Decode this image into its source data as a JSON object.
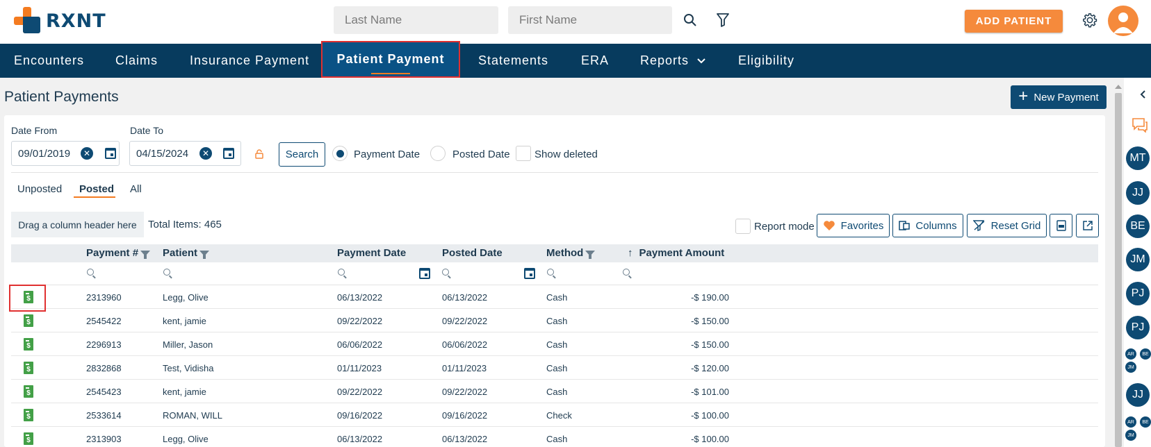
{
  "app": {
    "logo_text": "RXNT",
    "add_patient_label": "ADD PATIENT"
  },
  "header": {
    "last_name_placeholder": "Last Name",
    "first_name_placeholder": "First Name"
  },
  "nav": {
    "items": [
      {
        "label": "Encounters"
      },
      {
        "label": "Claims"
      },
      {
        "label": "Insurance Payment"
      },
      {
        "label": "Patient Payment",
        "active": true
      },
      {
        "label": "Statements"
      },
      {
        "label": "ERA"
      },
      {
        "label": "Reports"
      },
      {
        "label": "Eligibility"
      }
    ]
  },
  "page": {
    "title": "Patient Payments",
    "new_payment_label": "New Payment",
    "new_payment_icon": "+"
  },
  "filters": {
    "date_from_label": "Date From",
    "date_from_value": "09/01/2019",
    "date_to_label": "Date To",
    "date_to_value": "04/15/2024",
    "search_label": "Search",
    "payment_date_label": "Payment Date",
    "posted_date_label": "Posted Date",
    "show_deleted_label": "Show deleted",
    "selected_date_type": "Payment Date"
  },
  "tabs": [
    {
      "label": "Unposted"
    },
    {
      "label": "Posted",
      "active": true
    },
    {
      "label": "All"
    }
  ],
  "grid_toolbar": {
    "drag_hint": "Drag a column header here",
    "total_items": "Total Items: 465",
    "report_mode_label": "Report mode",
    "favorites_label": "Favorites",
    "columns_label": "Columns",
    "reset_grid_label": "Reset Grid"
  },
  "grid": {
    "headers": [
      "Payment #",
      "Patient",
      "Payment Date",
      "Posted Date",
      "Method",
      "Payment Amount"
    ],
    "rows": [
      {
        "payment_no": "2313960",
        "patient": "Legg, Olive",
        "payment_date": "06/13/2022",
        "posted_date": "06/13/2022",
        "method": "Cash",
        "amount": "-$ 190.00"
      },
      {
        "payment_no": "2545422",
        "patient": "kent, jamie",
        "payment_date": "09/22/2022",
        "posted_date": "09/22/2022",
        "method": "Cash",
        "amount": "-$ 150.00"
      },
      {
        "payment_no": "2296913",
        "patient": "Miller, Jason",
        "payment_date": "06/06/2022",
        "posted_date": "06/06/2022",
        "method": "Cash",
        "amount": "-$ 150.00"
      },
      {
        "payment_no": "2832868",
        "patient": "Test, Vidisha",
        "payment_date": "01/11/2023",
        "posted_date": "01/11/2023",
        "method": "Cash",
        "amount": "-$ 120.00"
      },
      {
        "payment_no": "2545423",
        "patient": "kent, jamie",
        "payment_date": "09/22/2022",
        "posted_date": "09/22/2022",
        "method": "Cash",
        "amount": "-$ 101.00"
      },
      {
        "payment_no": "2533614",
        "patient": "ROMAN, WILL",
        "payment_date": "09/16/2022",
        "posted_date": "09/16/2022",
        "method": "Check",
        "amount": "-$ 100.00"
      },
      {
        "payment_no": "2313903",
        "patient": "Legg, Olive",
        "payment_date": "06/13/2022",
        "posted_date": "06/13/2022",
        "method": "Cash",
        "amount": "-$ 100.00"
      }
    ]
  },
  "rail": {
    "avatars": [
      "MT",
      "JJ",
      "BE",
      "JM",
      "PJ",
      "PJ",
      "JJ"
    ],
    "small_group_1": [
      "AR",
      "BE",
      "JM"
    ],
    "small_group_2": [
      "AR",
      "BE",
      "JM"
    ]
  },
  "colors": {
    "brand_navy": "#073b5e",
    "accent_orange": "#f58a3c",
    "doc_green": "#43a047",
    "highlight_red": "#e03030"
  }
}
